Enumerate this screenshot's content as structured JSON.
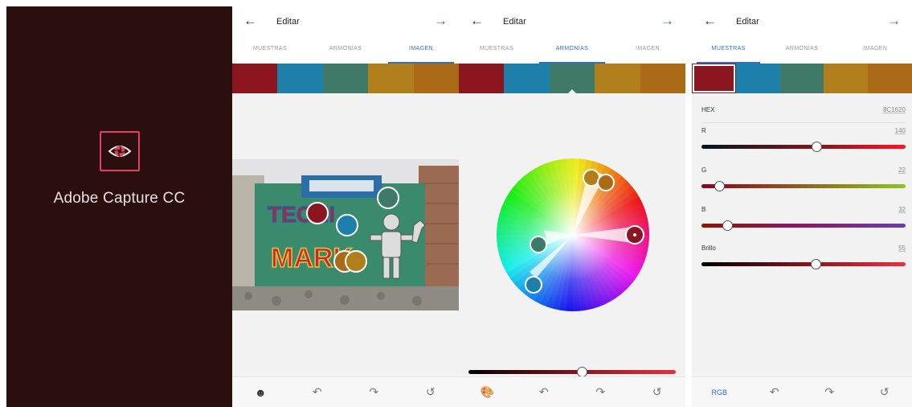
{
  "splash": {
    "title": "Adobe Capture CC",
    "logo_icon": "capture-aperture-icon"
  },
  "colors": {
    "swatches": [
      "#8c1620",
      "#1c80ab",
      "#3e7a67",
      "#b07f1c",
      "#ab6a16"
    ],
    "accent": "#2d6fce",
    "splash_bg": "#2b0e0e"
  },
  "panels": [
    {
      "back_icon": "arrow-left-icon",
      "title": "Editar",
      "forward_icon": "arrow-right-icon",
      "tabs": [
        "MUESTRAS",
        "ARMONÍAS",
        "IMAGEN"
      ],
      "active_tab": "IMAGEN",
      "bottom": {
        "left_icon": "face-icon",
        "undo_icon": "undo-icon",
        "redo_icon": "redo-icon",
        "reset_icon": "reset-icon"
      }
    },
    {
      "back_icon": "arrow-left-icon",
      "title": "Editar",
      "forward_icon": "arrow-right-icon",
      "tabs": [
        "MUESTRAS",
        "ARMONÍAS",
        "IMAGEN"
      ],
      "active_tab": "ARMONÍAS",
      "brightness_level": 0.55,
      "bottom": {
        "left_icon": "palette-icon",
        "undo_icon": "undo-icon",
        "redo_icon": "redo-icon",
        "reset_icon": "reset-icon"
      }
    },
    {
      "back_icon": "arrow-left-icon",
      "title": "Editar",
      "forward_icon": "arrow-right-icon",
      "tabs": [
        "MUESTRAS",
        "ARMONÍAS",
        "IMAGEN"
      ],
      "active_tab": "MUESTRAS",
      "selected_swatch": 0,
      "fields": {
        "hex_label": "HEX",
        "hex_value": "8C1620",
        "r_label": "R",
        "r_value": "140",
        "g_label": "G",
        "g_value": "22",
        "b_label": "B",
        "b_value": "32",
        "brillo_label": "Brillo",
        "brillo_value": "55"
      },
      "bottom": {
        "mode_label": "RGB",
        "undo_icon": "undo-icon",
        "redo_icon": "redo-icon",
        "reset_icon": "reset-icon"
      }
    }
  ],
  "photo": {
    "sign_text_1": "TECNI",
    "sign_text_2": "MARK"
  }
}
